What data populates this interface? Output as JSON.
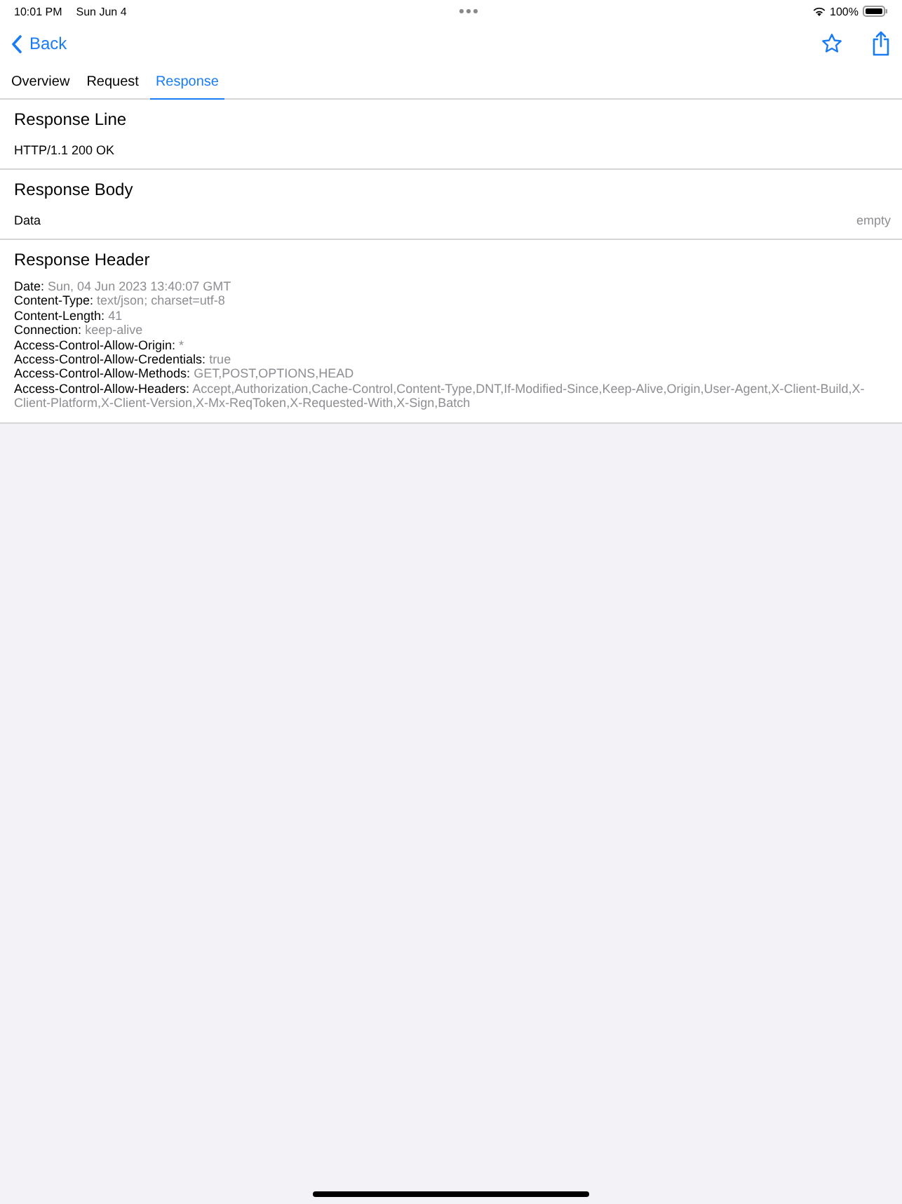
{
  "status_bar": {
    "time": "10:01 PM",
    "date": "Sun Jun 4",
    "battery": "100%"
  },
  "nav": {
    "back": "Back"
  },
  "tabs": [
    {
      "label": "Overview",
      "selected": false
    },
    {
      "label": "Request",
      "selected": false
    },
    {
      "label": "Response",
      "selected": true
    }
  ],
  "response_line": {
    "title": "Response Line",
    "value": "HTTP/1.1 200 OK"
  },
  "response_body": {
    "title": "Response Body",
    "label": "Data",
    "value": "empty"
  },
  "response_header": {
    "title": "Response Header",
    "headers": [
      {
        "name": "Date:",
        "value": "Sun, 04 Jun 2023 13:40:07 GMT"
      },
      {
        "name": "Content-Type:",
        "value": "text/json; charset=utf-8"
      },
      {
        "name": "Content-Length:",
        "value": "41"
      },
      {
        "name": "Connection:",
        "value": "keep-alive"
      },
      {
        "name": "Access-Control-Allow-Origin:",
        "value": "*"
      },
      {
        "name": "Access-Control-Allow-Credentials:",
        "value": "true"
      },
      {
        "name": "Access-Control-Allow-Methods:",
        "value": "GET,POST,OPTIONS,HEAD"
      },
      {
        "name": "Access-Control-Allow-Headers:",
        "value": "Accept,Authorization,Cache-Control,Content-Type,DNT,If-Modified-Since,Keep-Alive,Origin,User-Agent,X-Client-Build,X-Client-Platform,X-Client-Version,X-Mx-ReqToken,X-Requested-With,X-Sign,Batch"
      }
    ]
  }
}
